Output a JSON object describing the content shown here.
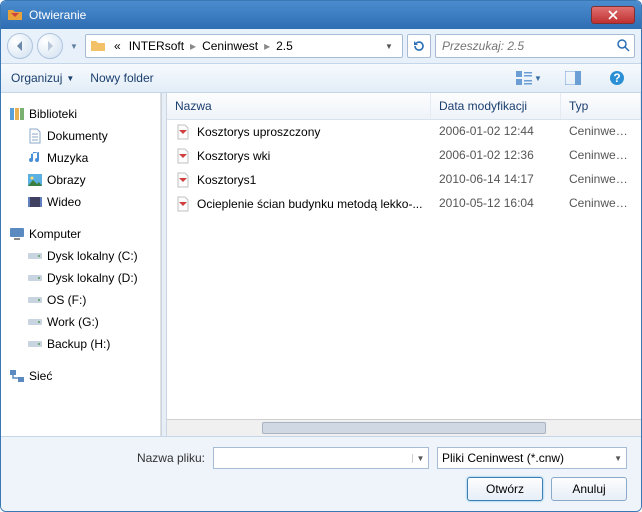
{
  "title": "Otwieranie",
  "breadcrumb": {
    "prefix": "«",
    "seg1": "INTERsoft",
    "seg2": "Ceninwest",
    "seg3": "2.5"
  },
  "search": {
    "placeholder": "Przeszukaj: 2.5"
  },
  "toolbar": {
    "organize": "Organizuj",
    "newfolder": "Nowy folder"
  },
  "columns": {
    "name": "Nazwa",
    "date": "Data modyfikacji",
    "type": "Typ"
  },
  "sidebar": {
    "libs": {
      "label": "Biblioteki",
      "docs": "Dokumenty",
      "music": "Muzyka",
      "pics": "Obrazy",
      "video": "Wideo"
    },
    "computer": {
      "label": "Komputer",
      "c": "Dysk lokalny (C:)",
      "d": "Dysk lokalny (D:)",
      "f": "OS (F:)",
      "g": "Work (G:)",
      "h": "Backup (H:)"
    },
    "network": {
      "label": "Sieć"
    }
  },
  "files": [
    {
      "name": "Kosztorys uproszczony",
      "date": "2006-01-02 12:44",
      "type": "Ceninwest Fi"
    },
    {
      "name": "Kosztorys wki",
      "date": "2006-01-02 12:36",
      "type": "Ceninwest Fi"
    },
    {
      "name": "Kosztorys1",
      "date": "2010-06-14 14:17",
      "type": "Ceninwest Fi"
    },
    {
      "name": "Ocieplenie ścian budynku metodą lekko-...",
      "date": "2010-05-12 16:04",
      "type": "Ceninwest Fi"
    }
  ],
  "bottom": {
    "filename_label": "Nazwa pliku:",
    "filter": "Pliki Ceninwest (*.cnw)",
    "open": "Otwórz",
    "cancel": "Anuluj"
  }
}
